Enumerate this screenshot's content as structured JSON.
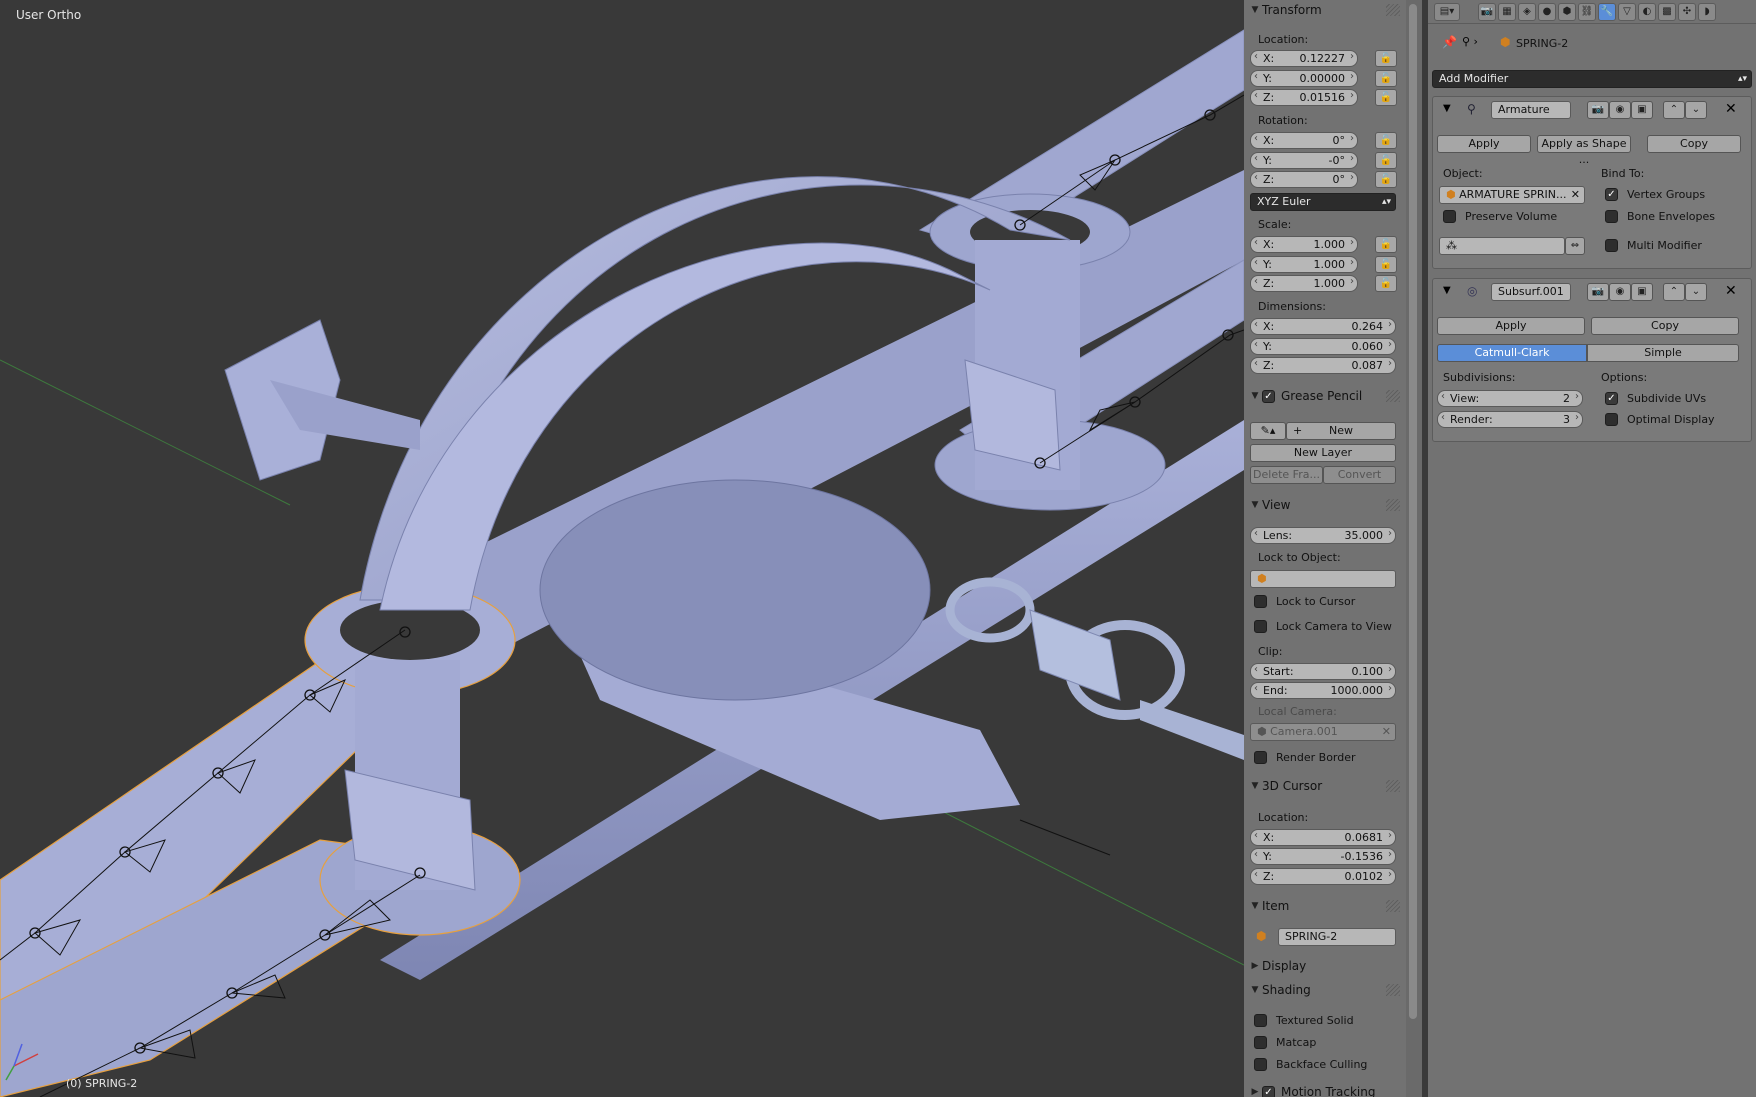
{
  "viewport": {
    "view_name": "User Ortho",
    "object_status": "(0) SPRING-2"
  },
  "npanel": {
    "transform": {
      "title": "Transform",
      "location_label": "Location:",
      "location": [
        {
          "axis": "X:",
          "value": "0.12227"
        },
        {
          "axis": "Y:",
          "value": "0.00000"
        },
        {
          "axis": "Z:",
          "value": "0.01516"
        }
      ],
      "rotation_label": "Rotation:",
      "rotation": [
        {
          "axis": "X:",
          "value": "0°"
        },
        {
          "axis": "Y:",
          "value": "-0°"
        },
        {
          "axis": "Z:",
          "value": "0°"
        }
      ],
      "rotation_mode": "XYZ Euler",
      "scale_label": "Scale:",
      "scale": [
        {
          "axis": "X:",
          "value": "1.000"
        },
        {
          "axis": "Y:",
          "value": "1.000"
        },
        {
          "axis": "Z:",
          "value": "1.000"
        }
      ],
      "dimensions_label": "Dimensions:",
      "dimensions": [
        {
          "axis": "X:",
          "value": "0.264"
        },
        {
          "axis": "Y:",
          "value": "0.060"
        },
        {
          "axis": "Z:",
          "value": "0.087"
        }
      ]
    },
    "grease_pencil": {
      "title": "Grease Pencil",
      "new_label": "New",
      "new_layer_label": "New Layer",
      "delete_frame_label": "Delete Fra...",
      "convert_label": "Convert"
    },
    "view": {
      "title": "View",
      "lens_key": "Lens:",
      "lens_value": "35.000",
      "lock_object_label": "Lock to Object:",
      "lock_cursor_label": "Lock to Cursor",
      "lock_camera_label": "Lock Camera to View",
      "clip_label": "Clip:",
      "clip_start_key": "Start:",
      "clip_start_value": "0.100",
      "clip_end_key": "End:",
      "clip_end_value": "1000.000",
      "local_camera_label": "Local Camera:",
      "local_camera_value": "Camera.001",
      "render_border_label": "Render Border"
    },
    "cursor": {
      "title": "3D Cursor",
      "location_label": "Location:",
      "location": [
        {
          "axis": "X:",
          "value": "0.0681"
        },
        {
          "axis": "Y:",
          "value": "-0.1536"
        },
        {
          "axis": "Z:",
          "value": "0.0102"
        }
      ]
    },
    "item": {
      "title": "Item",
      "name": "SPRING-2"
    },
    "display": {
      "title": "Display"
    },
    "shading": {
      "title": "Shading",
      "textured_solid": "Textured Solid",
      "matcap": "Matcap",
      "backface_culling": "Backface Culling"
    },
    "motion_tracking": {
      "title": "Motion Tracking"
    }
  },
  "properties": {
    "object_name": "SPRING-2",
    "add_modifier_label": "Add Modifier",
    "armature": {
      "name": "Armature",
      "apply_label": "Apply",
      "apply_shape_label": "Apply as Shape ...",
      "copy_label": "Copy",
      "object_label": "Object:",
      "object_value": "ARMATURE SPRIN...",
      "bind_to_label": "Bind To:",
      "vertex_groups_label": "Vertex Groups",
      "preserve_volume_label": "Preserve Volume",
      "bone_envelopes_label": "Bone Envelopes",
      "multi_modifier_label": "Multi Modifier"
    },
    "subsurf": {
      "name": "Subsurf.001",
      "apply_label": "Apply",
      "copy_label": "Copy",
      "catmull_label": "Catmull-Clark",
      "simple_label": "Simple",
      "subdivisions_label": "Subdivisions:",
      "view_key": "View:",
      "view_value": "2",
      "render_key": "Render:",
      "render_value": "3",
      "options_label": "Options:",
      "subdivide_uvs_label": "Subdivide UVs",
      "optimal_display_label": "Optimal Display"
    }
  },
  "colors": {
    "viewport_bg": "#393939",
    "panel_bg": "#727272",
    "accent": "#5b8ed8",
    "mesh": "#a9b0d6",
    "selection": "#e8a040"
  }
}
